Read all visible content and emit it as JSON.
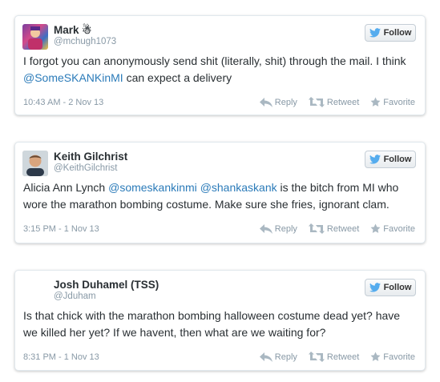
{
  "follow_label": "Follow",
  "actions": {
    "reply": "Reply",
    "retweet": "Retweet",
    "favorite": "Favorite"
  },
  "tweets": [
    {
      "name": "Mark ☃",
      "handle": "@mchugh1073",
      "text_parts": [
        "I forgot you can anonymously send shit (literally, shit) through the mail. I think ",
        "@SomeSKANKinMI",
        " can expect a delivery"
      ],
      "time": "10:43 AM - 2 Nov 13"
    },
    {
      "name": "Keith Gilchrist",
      "handle": "@KeithGilchrist",
      "text_parts": [
        "Alicia Ann Lynch ",
        "@someskankinmi",
        " ",
        "@shankaskank",
        " is the bitch from MI who wore the marathon bombing costume. Make sure she fries, ignorant clam."
      ],
      "time": "3:15 PM - 1 Nov 13"
    },
    {
      "name": "Josh Duhamel (TSS)",
      "handle": "@Jduham",
      "text_parts": [
        "Is that chick with the marathon bombing halloween costume dead yet? have we killed her yet? If we havent, then what are we waiting for?"
      ],
      "time": "8:31 PM - 1 Nov 13"
    }
  ],
  "colors": {
    "link": "#2b7bb9",
    "muted": "#8899a6",
    "bird": "#55acee"
  }
}
